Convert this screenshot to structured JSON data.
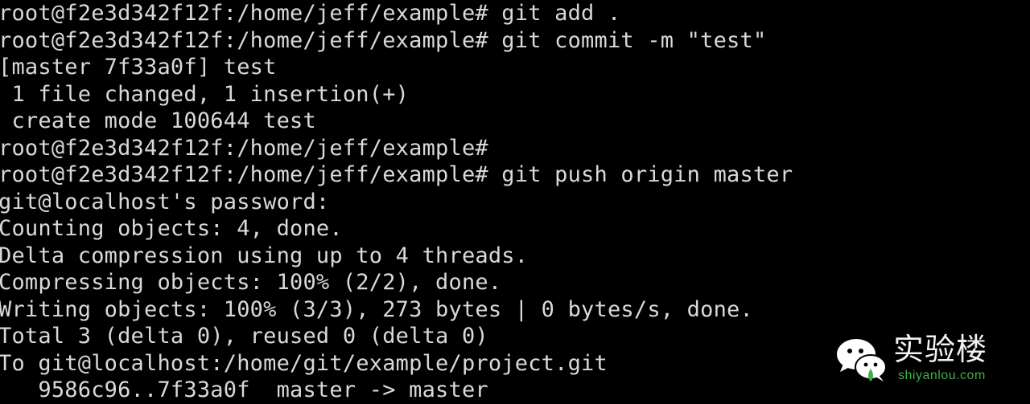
{
  "terminal": {
    "lines": [
      "root@f2e3d342f12f:/home/jeff/example# git add .",
      "root@f2e3d342f12f:/home/jeff/example# git commit -m \"test\"",
      "[master 7f33a0f] test",
      " 1 file changed, 1 insertion(+)",
      " create mode 100644 test",
      "root@f2e3d342f12f:/home/jeff/example#",
      "root@f2e3d342f12f:/home/jeff/example# git push origin master",
      "git@localhost's password:",
      "Counting objects: 4, done.",
      "Delta compression using up to 4 threads.",
      "Compressing objects: 100% (2/2), done.",
      "Writing objects: 100% (3/3), 273 bytes | 0 bytes/s, done.",
      "Total 3 (delta 0), reused 0 (delta 0)",
      "To git@localhost:/home/git/example/project.git",
      "   9586c96..7f33a0f  master -> master"
    ],
    "background_color": "#000000",
    "text_color": "#d9d9d9"
  },
  "watermark": {
    "title": "实验楼",
    "site": "shiyanlou.com",
    "icon": "wechat-icon",
    "accent_color": "#3fae49"
  }
}
